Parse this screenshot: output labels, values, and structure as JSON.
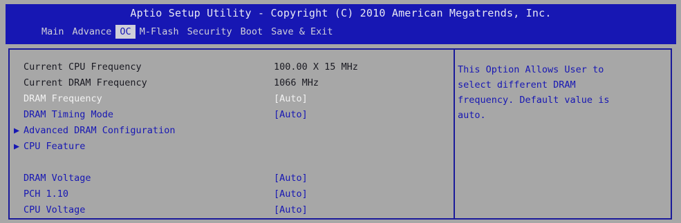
{
  "header": {
    "title": "Aptio Setup Utility - Copyright (C) 2010 American Megatrends, Inc.",
    "tabs": [
      {
        "label": "Main"
      },
      {
        "label": "Advance"
      },
      {
        "label": "OC"
      },
      {
        "label": "M-Flash"
      },
      {
        "label": "Security"
      },
      {
        "label": "Boot"
      },
      {
        "label": "Save & Exit"
      }
    ],
    "active_tab": "OC"
  },
  "settings": {
    "cpu_freq": {
      "label": "Current CPU Frequency",
      "value": "100.00 X 15 MHz"
    },
    "dram_freq_current": {
      "label": "Current DRAM Frequency",
      "value": "1066 MHz"
    },
    "dram_frequency": {
      "label": "DRAM Frequency",
      "value": "[Auto]"
    },
    "dram_timing": {
      "label": "DRAM Timing Mode",
      "value": "[Auto]"
    },
    "adv_dram": {
      "label": "Advanced DRAM Configuration"
    },
    "cpu_feature": {
      "label": "CPU Feature"
    },
    "dram_voltage": {
      "label": "DRAM Voltage",
      "value": "[Auto]"
    },
    "pch": {
      "label": "PCH 1.10",
      "value": "[Auto]"
    },
    "cpu_voltage": {
      "label": "CPU Voltage",
      "value": "[Auto]"
    }
  },
  "help": {
    "lines": [
      "This Option Allows User to",
      "select different DRAM",
      "frequency. Default value is",
      "auto."
    ]
  },
  "colors": {
    "header_bg": "#1717b3",
    "panel_bg": "#a7a7a7",
    "menu_text": "#1717b3",
    "selected_text": "#f2f2f2"
  }
}
